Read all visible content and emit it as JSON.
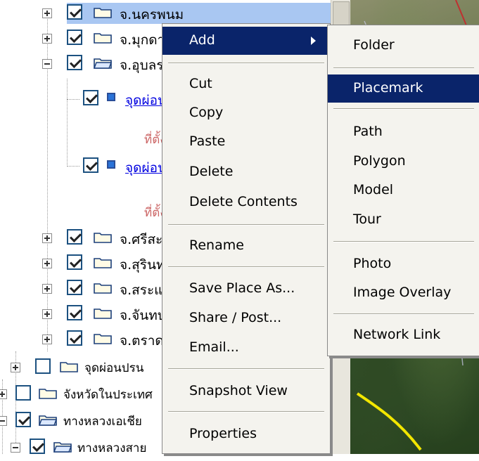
{
  "tree": {
    "items": [
      {
        "label": "จ.นครพนม",
        "checked": true
      },
      {
        "label": "จ.มุกดาหาร",
        "checked": true
      },
      {
        "label": "จ.อุบลราชธานี",
        "checked": true
      },
      {
        "label": "จุดผ่อนปรน",
        "checked": true,
        "sub": "ที่ตั้ง"
      },
      {
        "label": "จุดผ่อนปรน",
        "checked": true,
        "sub": "ที่ตั้ง"
      },
      {
        "label": "จ.ศรีสะเกษ",
        "checked": true
      },
      {
        "label": "จ.สุรินทร์",
        "checked": true
      },
      {
        "label": "จ.สระแก้ว",
        "checked": true
      },
      {
        "label": "จ.จันทบุรี",
        "checked": true
      },
      {
        "label": "จ.ตราด",
        "checked": true
      },
      {
        "label": "จุดผ่อนปรน",
        "checked": false
      },
      {
        "label": "จังหวัดในประเทศ",
        "checked": false
      },
      {
        "label": "ทางหลวงเอเชีย",
        "checked": true
      },
      {
        "label": "ทางหลวงสาย",
        "checked": true
      }
    ]
  },
  "context_menu": {
    "items": [
      "Add",
      "Cut",
      "Copy",
      "Paste",
      "Delete",
      "Delete Contents",
      "Rename",
      "Save Place As...",
      "Share / Post...",
      "Email...",
      "Snapshot View",
      "Properties"
    ]
  },
  "add_submenu": {
    "items": [
      "Folder",
      "Placemark",
      "Path",
      "Polygon",
      "Model",
      "Tour",
      "Photo",
      "Image Overlay",
      "Network Link"
    ],
    "highlighted": "Placemark"
  },
  "colors": {
    "menu_highlight": "#0a246a",
    "selection": "#a9c7f2",
    "link": "#0000e0"
  }
}
